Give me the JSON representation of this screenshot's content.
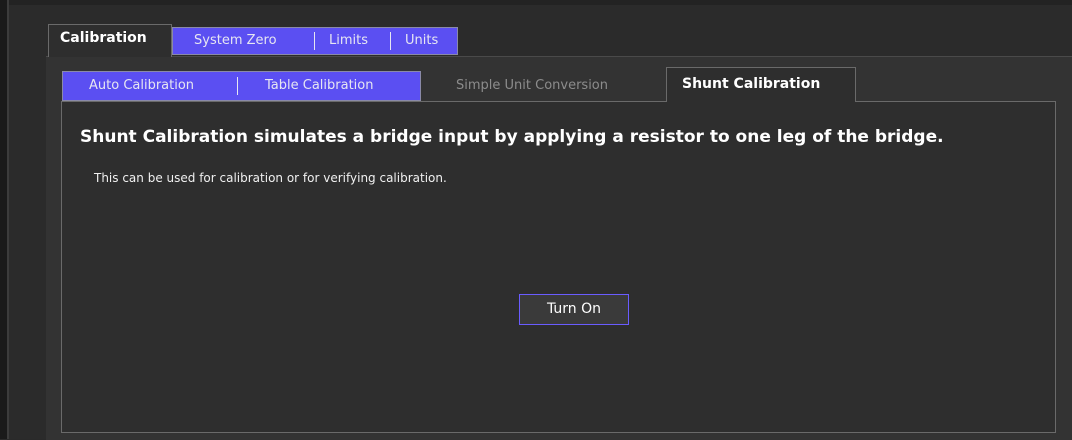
{
  "top_tabs": {
    "active": "Calibration",
    "items": [
      "System Zero",
      "Limits",
      "Units"
    ]
  },
  "sub_tabs": {
    "items": [
      "Auto Calibration",
      "Table Calibration"
    ],
    "disabled": "Simple Unit Conversion",
    "active": "Shunt Calibration"
  },
  "content": {
    "headline": "Shunt Calibration simulates a bridge input by applying a resistor to one leg of the bridge.",
    "description": "This can be used for calibration or for verifying calibration.",
    "button_label": "Turn On"
  },
  "colors": {
    "tab_accent": "#5b4ff2",
    "button_border": "#6a5cff",
    "background": "#2e2e2e"
  }
}
